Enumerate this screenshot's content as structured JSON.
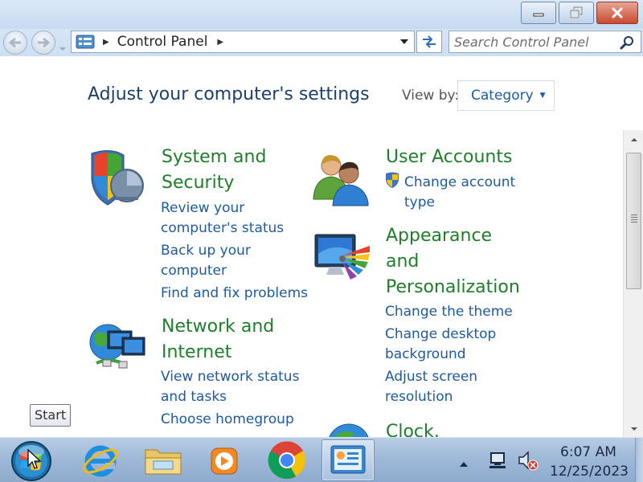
{
  "window": {
    "caption_buttons": [
      "minimize",
      "restore",
      "close"
    ]
  },
  "address": {
    "path": "Control Panel",
    "search_placeholder": "Search Control Panel"
  },
  "content": {
    "title": "Adjust your computer's settings",
    "view_by_label": "View by:",
    "view_by_value": "Category"
  },
  "categories": [
    {
      "title_lines": [
        "System and",
        "Security"
      ],
      "links": [
        [
          "Review your",
          "computer's status"
        ],
        [
          "Back up your",
          "computer"
        ],
        [
          "Find and fix problems"
        ]
      ],
      "icon": "shield-icon"
    },
    {
      "title_lines": [
        "User Accounts"
      ],
      "links": [
        [
          "Change account",
          "type"
        ]
      ],
      "icon": "users-icon"
    },
    {
      "title_lines": [
        "Appearance",
        "and",
        "Personalization"
      ],
      "links": [
        [
          "Change the theme"
        ],
        [
          "Change desktop",
          "background"
        ],
        [
          "Adjust screen",
          "resolution"
        ]
      ],
      "icon": "display-palette-icon"
    },
    {
      "title_lines": [
        "Network and",
        "Internet"
      ],
      "links": [
        [
          "View network status",
          "and tasks"
        ],
        [
          "Choose homegroup"
        ]
      ],
      "icon": "network-globe-icon"
    },
    {
      "title_lines": [
        "Clock,"
      ],
      "links": [],
      "icon": "clock-globe-icon"
    }
  ],
  "tooltip": "Start",
  "taskbar": {
    "items": [
      "internet-explorer-icon",
      "file-explorer-icon",
      "media-player-icon",
      "chrome-icon",
      "control-panel-icon"
    ],
    "active": "control-panel-icon",
    "time": "6:07 AM",
    "date": "12/25/2023"
  },
  "colors": {
    "title_blue": "#1d3f6e",
    "category_green": "#1f7d2b",
    "link_blue": "#1e5aa0",
    "taskbar": "#9fb9d8"
  }
}
